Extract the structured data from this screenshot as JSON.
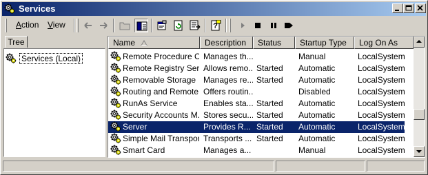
{
  "window": {
    "title": "Services",
    "app_icon": "services-gear-icon"
  },
  "caption_buttons": [
    "minimize-icon",
    "maximize-icon",
    "close-icon"
  ],
  "menu": [
    {
      "label": "Action",
      "underline": "A",
      "rest": "ction"
    },
    {
      "label": "View",
      "underline": "V",
      "rest": "iew"
    }
  ],
  "toolbar_icons": [
    "back-arrow-icon",
    "forward-arrow-icon",
    "up-folder-icon",
    "show-hide-tree-icon",
    "properties-icon",
    "refresh-icon",
    "export-list-icon",
    "help-icon",
    "start-service-icon",
    "stop-service-icon",
    "pause-service-icon",
    "restart-service-icon"
  ],
  "tree": {
    "tab_label": "Tree",
    "root_label": "Services (Local)"
  },
  "list": {
    "columns": [
      "Name",
      "Description",
      "Status",
      "Startup Type",
      "Log On As"
    ],
    "sorted_column": "Name",
    "selected_row": "Server",
    "rows": [
      {
        "name": "Remote Procedure C...",
        "description": "Manages th...",
        "status": "",
        "startup": "Manual",
        "logon": "LocalSystem"
      },
      {
        "name": "Remote Registry Ser...",
        "description": "Allows remo...",
        "status": "Started",
        "startup": "Automatic",
        "logon": "LocalSystem"
      },
      {
        "name": "Removable Storage",
        "description": "Manages re...",
        "status": "Started",
        "startup": "Automatic",
        "logon": "LocalSystem"
      },
      {
        "name": "Routing and Remote...",
        "description": "Offers routin...",
        "status": "",
        "startup": "Disabled",
        "logon": "LocalSystem"
      },
      {
        "name": "RunAs Service",
        "description": "Enables sta...",
        "status": "Started",
        "startup": "Automatic",
        "logon": "LocalSystem"
      },
      {
        "name": "Security Accounts M...",
        "description": "Stores secu...",
        "status": "Started",
        "startup": "Automatic",
        "logon": "LocalSystem"
      },
      {
        "name": "Server",
        "description": "Provides R...",
        "status": "Started",
        "startup": "Automatic",
        "logon": "LocalSystem"
      },
      {
        "name": "Simple Mail Transpor...",
        "description": "Transports ...",
        "status": "Started",
        "startup": "Automatic",
        "logon": "LocalSystem"
      },
      {
        "name": "Smart Card",
        "description": "Manages a...",
        "status": "",
        "startup": "Manual",
        "logon": "LocalSystem"
      }
    ]
  },
  "colors": {
    "title_start": "#0a246a",
    "title_end": "#a6caf0",
    "selection": "#0a246a",
    "face": "#d4d0c8"
  }
}
